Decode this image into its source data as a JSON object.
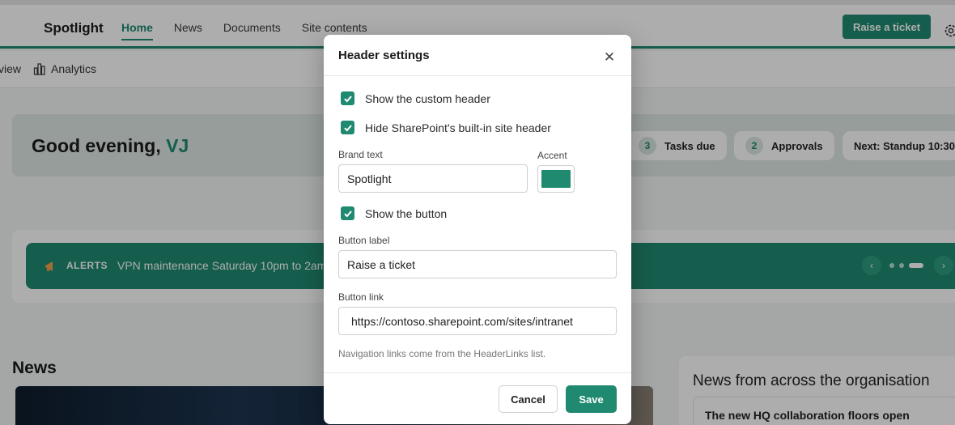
{
  "header": {
    "brand": "Spotlight",
    "nav": [
      "Home",
      "News",
      "Documents",
      "Site contents"
    ],
    "active_nav": "Home",
    "button_label": "Raise a ticket",
    "accent_color": "#1f8a70"
  },
  "subnav": {
    "items": [
      "view",
      "Analytics"
    ]
  },
  "greeting": {
    "text": "Good evening,",
    "name": "VJ",
    "pills": [
      {
        "count": "3",
        "label": "Tasks due"
      },
      {
        "count": "2",
        "label": "Approvals"
      },
      {
        "label": "Next: Standup 10:30"
      }
    ]
  },
  "alert": {
    "label": "ALERTS",
    "text": "VPN maintenance Saturday 10pm to 2am"
  },
  "news": {
    "title": "News",
    "org_title": "News from across the organisation",
    "org_item": "The new HQ collaboration floors open"
  },
  "dialog": {
    "title": "Header settings",
    "show_custom_header": "Show the custom header",
    "hide_builtin_header": "Hide SharePoint's built-in site header",
    "brand_text_label": "Brand text",
    "brand_text_value": "Spotlight",
    "accent_label": "Accent",
    "accent_color": "#1f8a70",
    "show_button": "Show the button",
    "button_label_label": "Button label",
    "button_label_value": "Raise a ticket",
    "button_link_label": "Button link",
    "button_link_value": "https://contoso.sharepoint.com/sites/intranet",
    "hint": "Navigation links come from the HeaderLinks list.",
    "cancel": "Cancel",
    "save": "Save"
  }
}
